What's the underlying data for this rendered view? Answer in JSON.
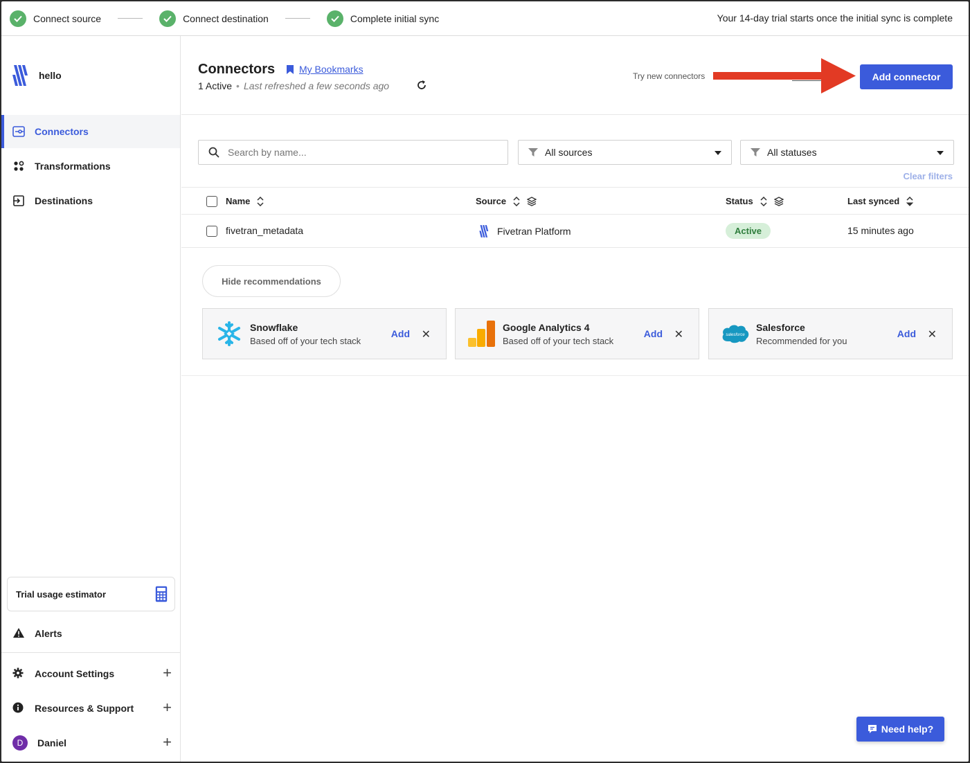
{
  "progress": {
    "steps": [
      {
        "label": "Connect source"
      },
      {
        "label": "Connect destination"
      },
      {
        "label": "Complete initial sync"
      }
    ],
    "trial_message": "Your 14-day trial starts once the initial sync is complete"
  },
  "sidebar": {
    "brand": "hello",
    "items": [
      {
        "label": "Connectors",
        "icon": "connectors-icon",
        "active": true
      },
      {
        "label": "Transformations",
        "icon": "transformations-icon"
      },
      {
        "label": "Destinations",
        "icon": "destinations-icon"
      }
    ],
    "estimator": "Trial usage estimator",
    "alerts": "Alerts",
    "account_settings": "Account Settings",
    "resources": "Resources & Support",
    "user": {
      "name": "Daniel",
      "initial": "D"
    }
  },
  "header": {
    "title": "Connectors",
    "bookmarks": "My Bookmarks",
    "active_count": "1 Active",
    "separator": "•",
    "refreshed": "Last refreshed a few seconds ago",
    "try_new": "Try new connectors",
    "add_button": "Add connector"
  },
  "filters": {
    "search_placeholder": "Search by name...",
    "sources": "All sources",
    "statuses": "All statuses",
    "clear": "Clear filters"
  },
  "table": {
    "columns": {
      "name": "Name",
      "source": "Source",
      "status": "Status",
      "last_synced": "Last synced"
    },
    "rows": [
      {
        "name": "fivetran_metadata",
        "source": "Fivetran Platform",
        "status": "Active",
        "last_synced": "15 minutes ago"
      }
    ]
  },
  "recommendations": {
    "hide_label": "Hide recommendations",
    "add_label": "Add",
    "items": [
      {
        "name": "Snowflake",
        "desc": "Based off of your tech stack"
      },
      {
        "name": "Google Analytics 4",
        "desc": "Based off of your tech stack"
      },
      {
        "name": "Salesforce",
        "desc": "Recommended for you",
        "logo_text": "salesforce"
      }
    ]
  },
  "help": {
    "label": "Need help?"
  },
  "colors": {
    "accent": "#3b5bdb",
    "success": "#5ab26a",
    "arrow": "#e23a24"
  }
}
